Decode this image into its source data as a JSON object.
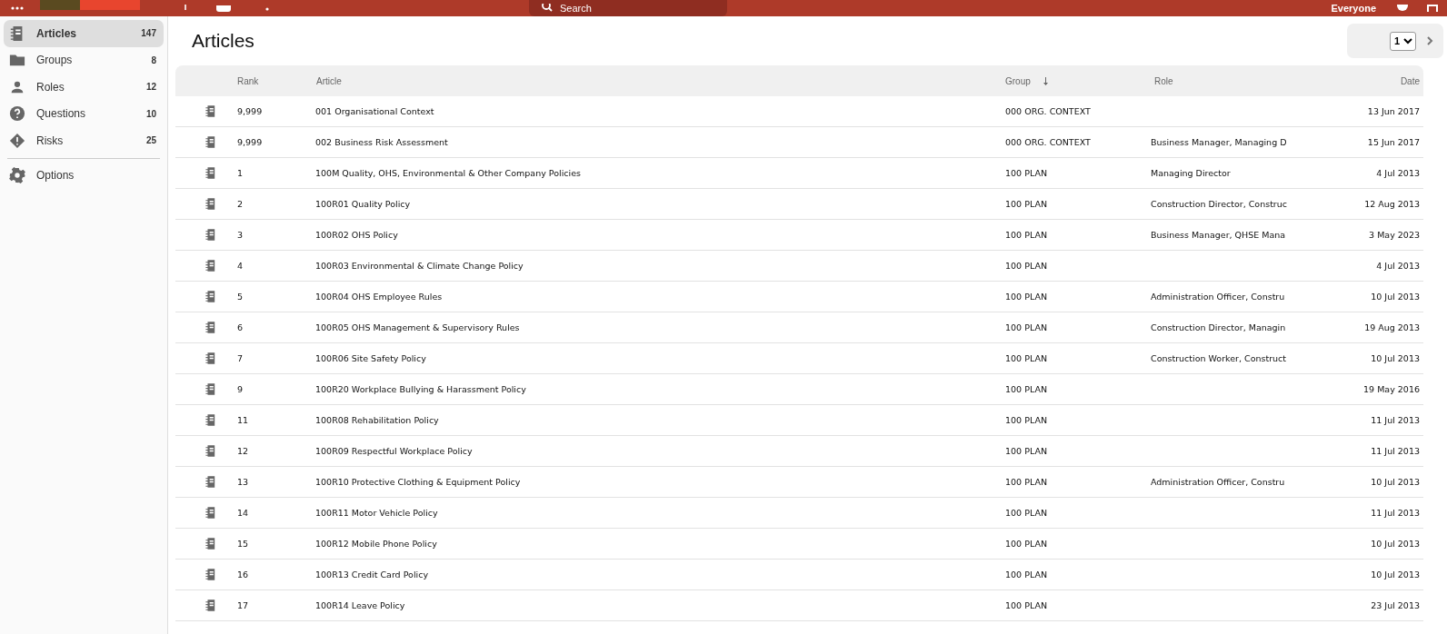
{
  "top_bar": {
    "search": {
      "placeholder": "Search"
    },
    "audience": "Everyone"
  },
  "sidebar": {
    "items": [
      {
        "kind": "articles",
        "label": "Articles",
        "count": "147",
        "selected": true
      },
      {
        "kind": "groups",
        "label": "Groups",
        "count": "8",
        "selected": false
      },
      {
        "kind": "roles",
        "label": "Roles",
        "count": "12",
        "selected": false
      },
      {
        "kind": "questions",
        "label": "Questions",
        "count": "10",
        "selected": false
      },
      {
        "kind": "risks",
        "label": "Risks",
        "count": "25",
        "selected": false
      }
    ],
    "footer_items": [
      {
        "kind": "options",
        "label": "Options",
        "selected": false
      }
    ]
  },
  "page": {
    "title": "Articles",
    "pager": {
      "page": "1"
    }
  },
  "table": {
    "columns": [
      {
        "label": "Rank"
      },
      {
        "label": "Article"
      },
      {
        "label": "Group",
        "sorted": true
      },
      {
        "label": "Role"
      },
      {
        "label": "Date"
      }
    ],
    "rows": [
      {
        "rank": "9,999",
        "article": "001 Organisational Context",
        "group": "000 ORG. CONTEXT",
        "date": "13 Jun 2017"
      },
      {
        "rank": "9,999",
        "article": "002 Business Risk Assessment",
        "group": "000 ORG. CONTEXT",
        "role": "Business Manager, Managing D",
        "date": "15 Jun 2017"
      },
      {
        "rank": "1",
        "article": "100M Quality, OHS, Environmental & Other Company Policies",
        "group": "100 PLAN",
        "role": "Managing Director",
        "date": "4 Jul 2013"
      },
      {
        "rank": "2",
        "article": "100R01 Quality Policy",
        "group": "100 PLAN",
        "role": "Construction Director, Construc",
        "date": "12 Aug 2013"
      },
      {
        "rank": "3",
        "article": "100R02 OHS Policy",
        "group": "100 PLAN",
        "role": "Business Manager, QHSE Mana",
        "date": "3 May 2023"
      },
      {
        "rank": "4",
        "article": "100R03 Environmental & Climate Change Policy",
        "group": "100 PLAN",
        "date": "4 Jul 2013"
      },
      {
        "rank": "5",
        "article": "100R04 OHS Employee Rules",
        "group": "100 PLAN",
        "role": "Administration Officer, Constru",
        "date": "10 Jul 2013"
      },
      {
        "rank": "6",
        "article": "100R05 OHS Management & Supervisory Rules",
        "group": "100 PLAN",
        "role": "Construction Director, Managin",
        "date": "19 Aug 2013"
      },
      {
        "rank": "7",
        "article": "100R06 Site Safety Policy",
        "group": "100 PLAN",
        "role": "Construction Worker, Construct",
        "date": "10 Jul 2013"
      },
      {
        "rank": "9",
        "article": "100R20 Workplace Bullying & Harassment Policy",
        "group": "100 PLAN",
        "date": "19 May 2016"
      },
      {
        "rank": "11",
        "article": "100R08 Rehabilitation Policy",
        "group": "100 PLAN",
        "date": "11 Jul 2013"
      },
      {
        "rank": "12",
        "article": "100R09 Respectful Workplace Policy",
        "group": "100 PLAN",
        "date": "11 Jul 2013"
      },
      {
        "rank": "13",
        "article": "100R10 Protective Clothing & Equipment Policy",
        "group": "100 PLAN",
        "role": "Administration Officer, Constru",
        "date": "10 Jul 2013"
      },
      {
        "rank": "14",
        "article": "100R11 Motor Vehicle Policy",
        "group": "100 PLAN",
        "date": "11 Jul 2013"
      },
      {
        "rank": "15",
        "article": "100R12 Mobile Phone Policy",
        "group": "100 PLAN",
        "date": "10 Jul 2013"
      },
      {
        "rank": "16",
        "article": "100R13 Credit Card Policy",
        "group": "100 PLAN",
        "date": "10 Jul 2013"
      },
      {
        "rank": "17",
        "article": "100R14 Leave Policy",
        "group": "100 PLAN",
        "date": "23 Jul 2013"
      }
    ]
  }
}
